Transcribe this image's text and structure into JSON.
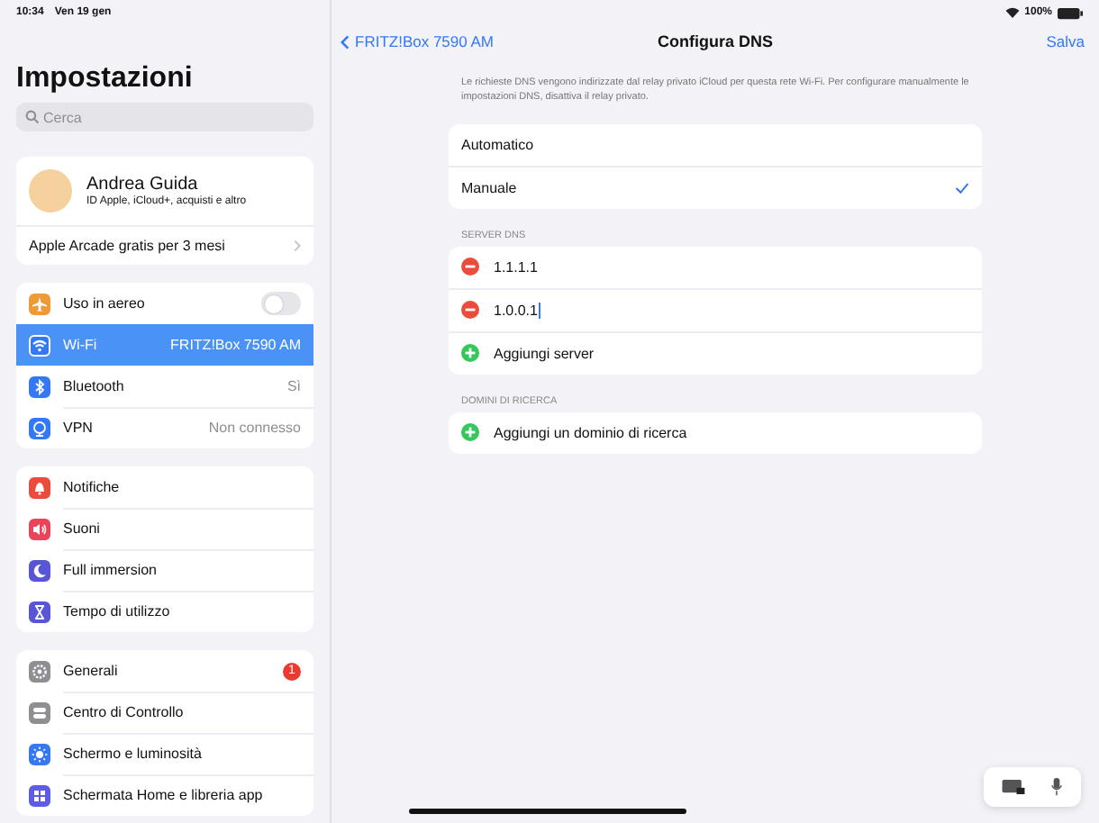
{
  "status_bar": {
    "time": "10:34",
    "date": "Ven 19 gen",
    "battery": "100%"
  },
  "sidebar": {
    "title": "Impostazioni",
    "search": {
      "placeholder": "Cerca"
    },
    "account": {
      "name": "Andrea Guida",
      "subtitle": "ID Apple, iCloud+, acquisti e altro"
    },
    "promo": "Apple Arcade gratis per 3 mesi",
    "groups": [
      {
        "items": [
          {
            "label": "Uso in aereo",
            "kind": "toggle",
            "on": false,
            "selected": false,
            "color": "#f09a37"
          },
          {
            "label": "Wi-Fi",
            "kind": "value",
            "value": "FRITZ!Box 7590 AM",
            "selected": true,
            "color": "#3478f6"
          },
          {
            "label": "Bluetooth",
            "kind": "value",
            "value": "Sì",
            "selected": false,
            "color": "#3478f6"
          },
          {
            "label": "VPN",
            "kind": "value",
            "value": "Non connesso",
            "selected": false,
            "color": "#3478f6"
          }
        ]
      },
      {
        "items": [
          {
            "label": "Notifiche",
            "kind": "plain",
            "selected": false,
            "color": "#eb4d3d"
          },
          {
            "label": "Suoni",
            "kind": "plain",
            "selected": false,
            "color": "#eb445a"
          },
          {
            "label": "Full immersion",
            "kind": "plain",
            "selected": false,
            "color": "#5856d6"
          },
          {
            "label": "Tempo di utilizzo",
            "kind": "plain",
            "selected": false,
            "color": "#5856d6"
          }
        ]
      },
      {
        "items": [
          {
            "label": "Generali",
            "kind": "badge",
            "badge": "1",
            "selected": false,
            "color": "#8e8e93"
          },
          {
            "label": "Centro di Controllo",
            "kind": "plain",
            "selected": false,
            "color": "#8e8e93"
          },
          {
            "label": "Schermo e luminosità",
            "kind": "plain",
            "selected": false,
            "color": "#3478f6"
          },
          {
            "label": "Schermata Home e libreria app",
            "kind": "plain",
            "selected": false,
            "color": "#5e5ce6"
          }
        ]
      }
    ]
  },
  "detail": {
    "back": "FRITZ!Box 7590 AM",
    "title": "Configura DNS",
    "save": "Salva",
    "note": "Le richieste DNS vengono indirizzate dal relay privato iCloud per questa rete Wi-Fi. Per configurare manualmente le impostazioni DNS, disattiva il relay privato.",
    "modes": [
      {
        "label": "Automatico",
        "selected": false
      },
      {
        "label": "Manuale",
        "selected": true
      }
    ],
    "dns_section": {
      "header": "SERVER DNS",
      "servers": [
        {
          "value": "1.1.1.1",
          "editing": false
        },
        {
          "value": "1.0.0.1",
          "editing": true
        }
      ],
      "add": "Aggiungi server"
    },
    "search_section": {
      "header": "DOMINI DI RICERCA",
      "add": "Aggiungi un dominio di ricerca"
    }
  }
}
